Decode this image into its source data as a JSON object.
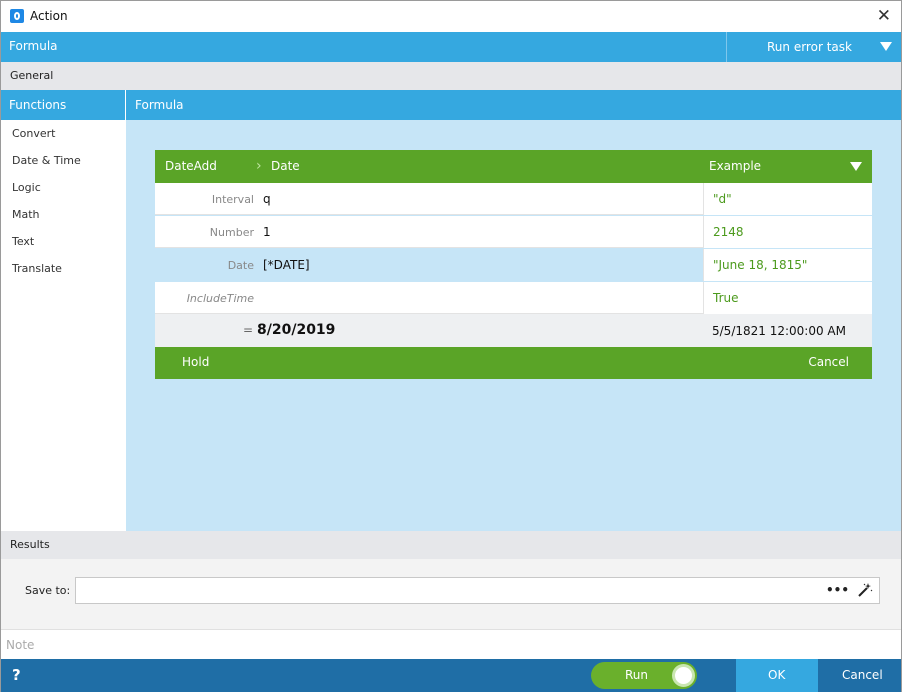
{
  "window": {
    "title": "Action"
  },
  "formula_bar": {
    "label": "Formula",
    "run_error_task": "Run error task"
  },
  "general": {
    "label": "General"
  },
  "functions": {
    "header": "Functions",
    "items": [
      "Convert",
      "Date & Time",
      "Logic",
      "Math",
      "Text",
      "Translate"
    ]
  },
  "formula_panel": {
    "header": "Formula"
  },
  "card": {
    "function_name": "DateAdd",
    "breadcrumb": "Date",
    "example_header": "Example",
    "params": [
      {
        "label": "Interval",
        "value": "q",
        "example": "\"d\""
      },
      {
        "label": "Number",
        "value": "1",
        "example": "2148"
      },
      {
        "label": "Date",
        "value": "[*DATE]",
        "example": "\"June 18, 1815\""
      },
      {
        "label": "IncludeTime",
        "value": "",
        "example": "True"
      }
    ],
    "result_eq": "=",
    "result_value": "8/20/2019",
    "result_example": "5/5/1821 12:00:00 AM",
    "hold_label": "Hold",
    "cancel_label": "Cancel"
  },
  "results": {
    "header": "Results",
    "save_to_label": "Save to:",
    "save_to_value": "",
    "browse_label": "•••"
  },
  "note": {
    "placeholder": "Note"
  },
  "bottom": {
    "help": "?",
    "run_label": "Run",
    "ok_label": "OK",
    "cancel_label": "Cancel"
  },
  "colors": {
    "header_blue": "#35a8e0",
    "card_green": "#5aa427",
    "canvas_bg": "#c6e5f7",
    "bottom_blue": "#1f6ea6",
    "example_green": "#4c9a1d"
  }
}
